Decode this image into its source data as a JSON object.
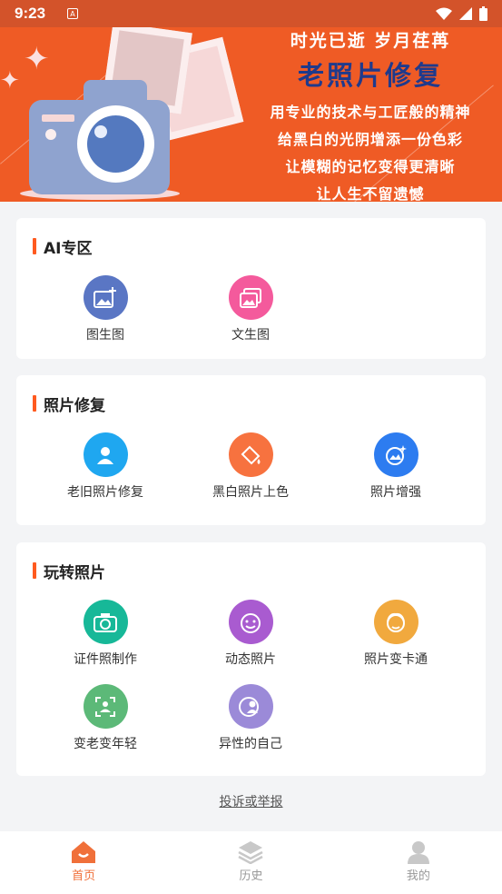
{
  "status_bar": {
    "time": "9:23",
    "notification_letter": "A"
  },
  "banner": {
    "line1": "时光已逝 岁月荏苒",
    "headline": "老照片修复",
    "line3": "用专业的技术与工匠般的精神",
    "line4": "给黑白的光阴增添一份色彩",
    "line5": "让模糊的记忆变得更清晰",
    "line6": "让人生不留遗憾"
  },
  "sections": [
    {
      "title": "AI专区",
      "items": [
        {
          "label": "图生图",
          "icon": "image-plus-icon",
          "color": "#5a76c4"
        },
        {
          "label": "文生图",
          "icon": "gallery-icon",
          "color": "#f45a9c"
        }
      ]
    },
    {
      "title": "照片修复",
      "items": [
        {
          "label": "老旧照片修复",
          "icon": "person-photo-icon",
          "color": "#1fa7f0"
        },
        {
          "label": "黑白照片上色",
          "icon": "paint-bucket-icon",
          "color": "#f7723f"
        },
        {
          "label": "照片增强",
          "icon": "enhance-icon",
          "color": "#2d7cf0"
        }
      ]
    },
    {
      "title": "玩转照片",
      "items": [
        {
          "label": "证件照制作",
          "icon": "camera-icon",
          "color": "#17b898"
        },
        {
          "label": "动态照片",
          "icon": "smile-face-icon",
          "color": "#a95bd0"
        },
        {
          "label": "照片变卡通",
          "icon": "cartoon-face-icon",
          "color": "#f1a93e"
        },
        {
          "label": "变老变年轻",
          "icon": "face-scan-icon",
          "color": "#5cb978"
        },
        {
          "label": "异性的自己",
          "icon": "profile-swap-icon",
          "color": "#9b8ad8"
        }
      ]
    }
  ],
  "report_link": "投诉或举报",
  "tabs": [
    {
      "label": "首页",
      "icon": "home-icon",
      "active": true
    },
    {
      "label": "历史",
      "icon": "layers-icon",
      "active": false
    },
    {
      "label": "我的",
      "icon": "user-icon",
      "active": false
    }
  ],
  "colors": {
    "accent": "#ef5b25",
    "tab_active": "#f0703a"
  }
}
